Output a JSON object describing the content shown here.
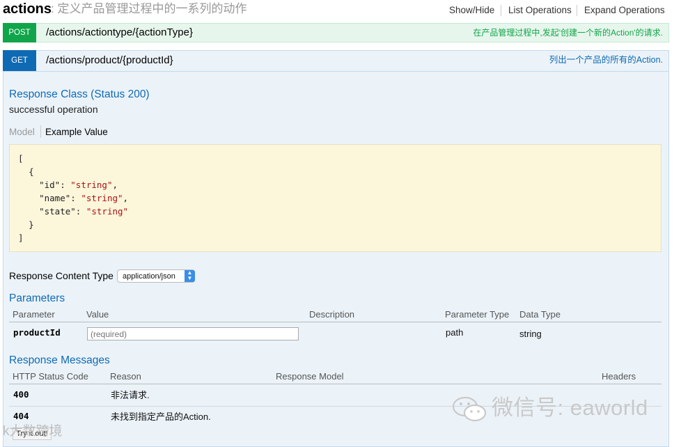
{
  "header": {
    "resource_name": "actions",
    "resource_desc": ": 定义产品管理过程中的一系列的动作",
    "ops": [
      "Show/Hide",
      "List Operations",
      "Expand Operations"
    ]
  },
  "post_op": {
    "method": "POST",
    "path": "/actions/actiontype/{actionType}",
    "summary": "在产品管理过程中,发起'创建一个新的Action'的请求."
  },
  "get_op": {
    "method": "GET",
    "path": "/actions/product/{productId}",
    "summary": "列出一个产品的所有的Action.",
    "response_class_title": "Response Class (Status 200)",
    "response_class_desc": "successful operation",
    "tabs": [
      "Model",
      "Example Value"
    ],
    "example_value": {
      "open_bracket": "[",
      "open_brace": "{",
      "fields": [
        {
          "key": "\"id\"",
          "value": "\"string\"",
          "sep": ","
        },
        {
          "key": "\"name\"",
          "value": "\"string\"",
          "sep": ","
        },
        {
          "key": "\"state\"",
          "value": "\"string\"",
          "sep": ""
        }
      ],
      "close_brace": "}",
      "close_bracket": "]"
    },
    "content_type_label": "Response Content Type",
    "content_type_selected": "application/json",
    "parameters_title": "Parameters",
    "param_headers": [
      "Parameter",
      "Value",
      "Description",
      "Parameter Type",
      "Data Type"
    ],
    "params": [
      {
        "name": "productId",
        "placeholder": "(required)",
        "description": "",
        "param_type": "path",
        "data_type": "string"
      }
    ],
    "response_messages_title": "Response Messages",
    "resp_headers": [
      "HTTP Status Code",
      "Reason",
      "Response Model",
      "Headers"
    ],
    "responses": [
      {
        "code": "400",
        "reason": "非法请求."
      },
      {
        "code": "404",
        "reason": "未找到指定产品的Action."
      }
    ],
    "try_button": "Try it out!"
  },
  "watermarks": {
    "right": "微信号: eaworld",
    "left": "k大数跨境"
  },
  "colors": {
    "post_green": "#10a54a",
    "get_blue": "#0f6ab4",
    "sample_bg": "#fcf6db"
  }
}
